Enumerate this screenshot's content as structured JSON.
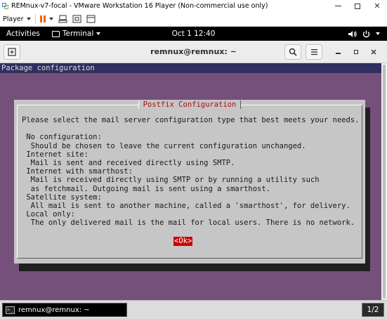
{
  "vmware": {
    "window_title": "REMnux-v7-focal - VMware Workstation 16 Player (Non-commercial use only)",
    "minimize_icon": "minimize-icon",
    "maximize_icon": "maximize-icon",
    "close_label": "✕",
    "player_menu_label": "Player",
    "accent_color": "#e8641b"
  },
  "gnome": {
    "activities_label": "Activities",
    "app_menu_label": "Terminal",
    "clock": "Oct 1  12:40",
    "tray_icons": [
      "volume-icon",
      "power-icon"
    ]
  },
  "terminal": {
    "title": "remnux@remnux: ~",
    "header_icons": [
      "new-tab-icon",
      "search-icon",
      "hamburger-menu-icon"
    ],
    "background_color": "#75507b",
    "package_line": "Package configuration"
  },
  "dialog": {
    "title": "Postfix Configuration",
    "body": "Please select the mail server configuration type that best meets your needs.\n\n No configuration:\n  Should be chosen to leave the current configuration unchanged.\n Internet site:\n  Mail is sent and received directly using SMTP.\n Internet with smarthost:\n  Mail is received directly using SMTP or by running a utility such\n  as fetchmail. Outgoing mail is sent using a smarthost.\n Satellite system:\n  All mail is sent to another machine, called a 'smarthost', for delivery.\n Local only:\n  The only delivered mail is the mail for local users. There is no network.",
    "ok_label": "<Ok>"
  },
  "taskbar": {
    "task_label": "remnux@remnux: ~",
    "task_icon_glyph": ">_",
    "workspace": "1/2"
  }
}
